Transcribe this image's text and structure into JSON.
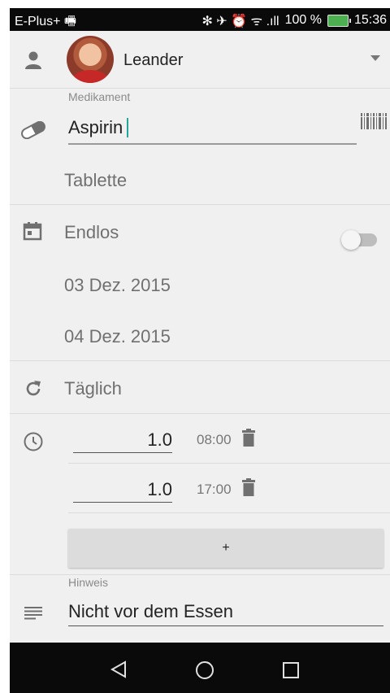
{
  "status_bar": {
    "carrier": "E-Plus+ 🖷",
    "icons_text": "✻ ✈ ⏰ ᯤ .ıll",
    "battery_percent": "100 %",
    "time": "15:36"
  },
  "user": {
    "name": "Leander"
  },
  "medication": {
    "label": "Medikament",
    "name": "Aspirin",
    "form": "Tablette"
  },
  "schedule": {
    "endless_label": "Endlos",
    "endless_on": false,
    "start_date": "03 Dez. 2015",
    "end_date": "04 Dez. 2015"
  },
  "recurrence": {
    "label": "Täglich"
  },
  "doses": [
    {
      "amount": "1.0",
      "time": "08:00"
    },
    {
      "amount": "1.0",
      "time": "17:00"
    }
  ],
  "add_button": {
    "label": "+"
  },
  "note": {
    "label": "Hinweis",
    "value": "Nicht vor dem Essen"
  },
  "colors": {
    "accent": "#26a69a",
    "background": "#f1f0f1",
    "icon": "#707070"
  }
}
